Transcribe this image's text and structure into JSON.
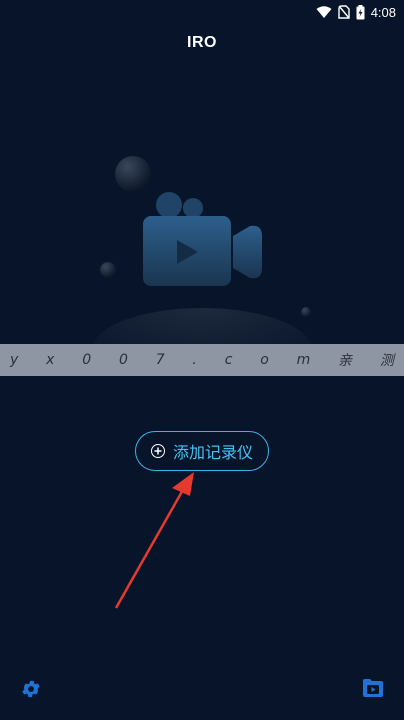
{
  "status_bar": {
    "time": "4:08",
    "icons": [
      "wifi-icon",
      "no-sim-icon",
      "battery-icon"
    ]
  },
  "app": {
    "title": "IRO"
  },
  "hero": {
    "icon": "video-camera-icon"
  },
  "watermark": {
    "chars": [
      "y",
      "x",
      "0",
      "0",
      "7",
      ".",
      "c",
      "o",
      "m",
      "亲",
      "测"
    ]
  },
  "actions": {
    "add_recorder_label": "添加记录仪"
  },
  "bottom_bar": {
    "settings_icon": "gear-icon",
    "folder_icon": "video-folder-icon"
  },
  "colors": {
    "background": "#07142a",
    "accent": "#39b6e8",
    "annotation_arrow": "#e53a2d",
    "icon_blue": "#1f73d6"
  }
}
